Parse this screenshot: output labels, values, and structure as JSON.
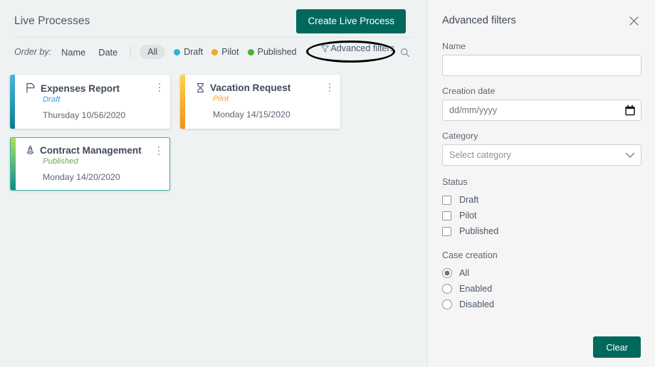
{
  "colors": {
    "accent_teal": "#00695c",
    "draft": "#29b6d8",
    "pilot": "#f5a623",
    "published": "#4caf2f",
    "left_bg": "#eef2f2",
    "right_bg": "#f5f5f5",
    "selected_border": "#3cb3a8",
    "highlight_ring": "#000000"
  },
  "left": {
    "page_title": "Live Processes",
    "create_button": "Create Live Process",
    "toolbar": {
      "order_by_label": "Order by:",
      "order_options": [
        "Name",
        "Date"
      ],
      "filter_all": "All",
      "status_chips": [
        {
          "label": "Draft",
          "color": "#29b6d8"
        },
        {
          "label": "Pilot",
          "color": "#f5a623"
        },
        {
          "label": "Published",
          "color": "#4caf2f"
        }
      ],
      "advanced_filters": "Advanced filters",
      "funnel_icon": "funnel-icon",
      "search_icon": "search-icon"
    },
    "cards": [
      {
        "title": "Expenses Report",
        "status": "Draft",
        "status_color": "#3f9fd1",
        "date": "Thursday 10/56/2020",
        "icon": "page-flag-icon",
        "accent_top": "#4fb3d9",
        "accent_bottom": "#0e7c8f",
        "selected": false
      },
      {
        "title": "Vacation Request",
        "status": "Pilot",
        "status_color": "#e8a33d",
        "date": "Monday 14/15/2020",
        "icon": "hourglass-icon",
        "accent_top": "#ffd24d",
        "accent_bottom": "#f5901e",
        "selected": false
      },
      {
        "title": "Contract Management",
        "status": "Published",
        "status_color": "#6aa84f",
        "date": "Monday 14/20/2020",
        "icon": "rocket-icon",
        "accent_top": "#a9d84f",
        "accent_bottom": "#0e8b8b",
        "selected": true
      }
    ]
  },
  "right": {
    "title": "Advanced filters",
    "close_icon": "close-icon",
    "name": {
      "label": "Name",
      "value": "",
      "placeholder": ""
    },
    "creation_date": {
      "label": "Creation date",
      "value": "",
      "placeholder": "dd/mm/yyyy",
      "icon": "calendar-icon"
    },
    "category": {
      "label": "Category",
      "selected": "Select category",
      "options": [
        "Select category"
      ],
      "icon": "chevron-down-icon"
    },
    "status": {
      "label": "Status",
      "options": [
        {
          "label": "Draft",
          "checked": false
        },
        {
          "label": "Pilot",
          "checked": false
        },
        {
          "label": "Published",
          "checked": false
        }
      ]
    },
    "case_creation": {
      "label": "Case creation",
      "options": [
        {
          "label": "All",
          "checked": true
        },
        {
          "label": "Enabled",
          "checked": false
        },
        {
          "label": "Disabled",
          "checked": false
        }
      ]
    },
    "clear_button": "Clear"
  }
}
